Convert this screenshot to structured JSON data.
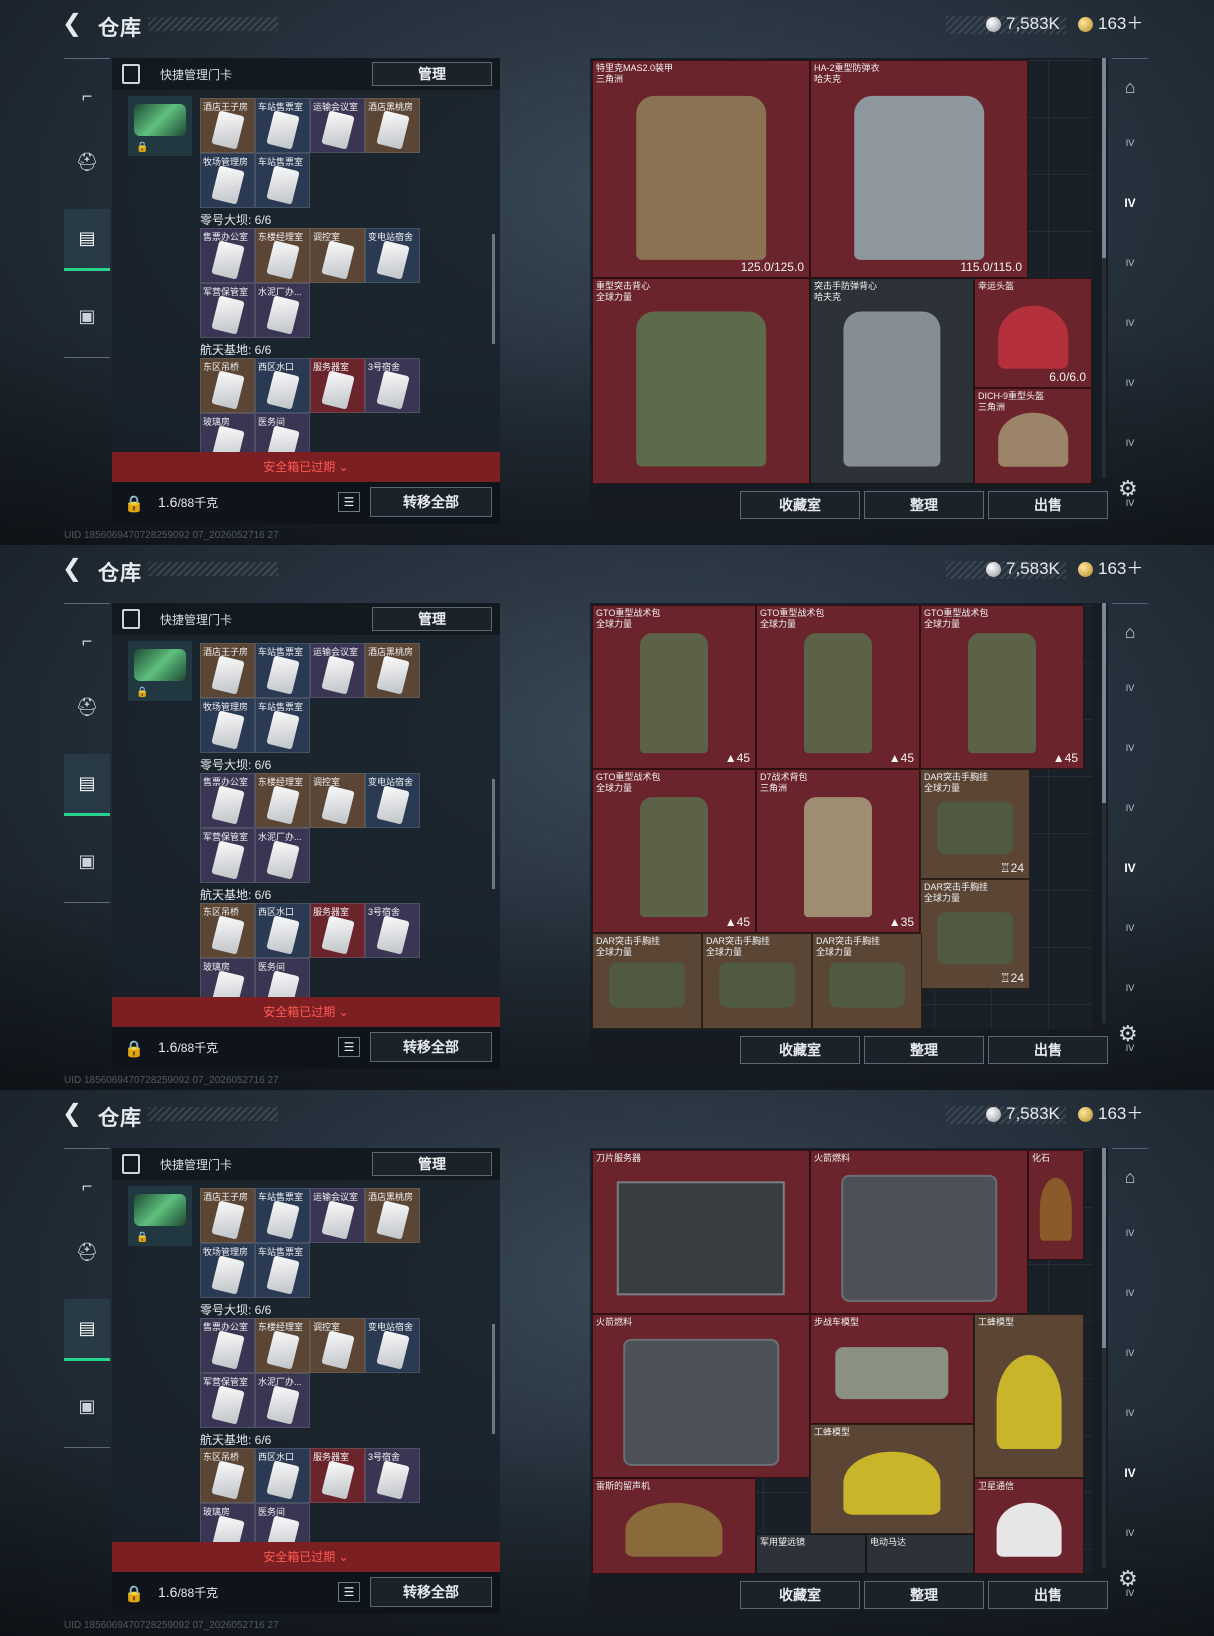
{
  "header": {
    "back": "❮",
    "title": "仓库",
    "currency1": "7,583K",
    "currency2": "163＋"
  },
  "card_panel": {
    "title": "快捷管理门卡",
    "manage": "管理",
    "groups": [
      {
        "label": "零号大坝: 6/6"
      },
      {
        "label": "航天基地: 6/6"
      }
    ],
    "cards": [
      "酒店王子房",
      "车站售票室",
      "运输会议室",
      "酒店黑桃房",
      "牧场管理房",
      "车站售票室",
      "售票办公室",
      "东楼经理室",
      "调控室",
      "变电站宿舍",
      "军营保管室",
      "水泥厂办...",
      "东区吊桥",
      "西区水口",
      "服务器室",
      "3号宿舍",
      "玻璃房",
      "医务间"
    ],
    "expired": "安全箱已过期 ⌄",
    "weight": "1.6",
    "weight_unit": "/88千克",
    "list_icon": "☰",
    "transfer": "转移全部"
  },
  "screens": [
    {
      "items": [
        {
          "name": "特里克MAS2.0装甲",
          "origin": "三角洲",
          "stat": "125.0/125.0"
        },
        {
          "name": "HA-2重型防弹衣",
          "origin": "哈夫克",
          "stat": "115.0/115.0"
        },
        {
          "name": "重型突击背心",
          "origin": "全球力量",
          "stat": ""
        },
        {
          "name": "突击手防弹背心",
          "origin": "哈夫克",
          "stat": ""
        },
        {
          "name": "幸运头盔",
          "origin": "",
          "stat": "6.0/6.0"
        },
        {
          "name": "DICH-9重型头盔",
          "origin": "三角洲",
          "stat": ""
        }
      ]
    },
    {
      "items": [
        {
          "name": "GTO重型战术包",
          "origin": "全球力量",
          "stat": "▲45"
        },
        {
          "name": "GTO重型战术包",
          "origin": "全球力量",
          "stat": "▲45"
        },
        {
          "name": "GTO重型战术包",
          "origin": "全球力量",
          "stat": "▲45"
        },
        {
          "name": "GTO重型战术包",
          "origin": "全球力量",
          "stat": "▲45"
        },
        {
          "name": "D7战术背包",
          "origin": "三角洲",
          "stat": "▲35"
        },
        {
          "name": "DAR突击手胸挂",
          "origin": "全球力量",
          "stat": "♖24"
        },
        {
          "name": "DAR突击手胸挂",
          "origin": "全球力量",
          "stat": "♖24"
        },
        {
          "name": "DAR突击手胸挂",
          "origin": "全球力量",
          "stat": ""
        },
        {
          "name": "DAR突击手胸挂",
          "origin": "全球力量",
          "stat": ""
        },
        {
          "name": "DAR突击手胸挂",
          "origin": "全球力量",
          "stat": ""
        }
      ]
    },
    {
      "items": [
        {
          "name": "刀片服务器",
          "origin": "",
          "stat": ""
        },
        {
          "name": "火箭燃料",
          "origin": "",
          "stat": ""
        },
        {
          "name": "化石",
          "origin": "",
          "stat": ""
        },
        {
          "name": "火箭燃料",
          "origin": "",
          "stat": ""
        },
        {
          "name": "步战车模型",
          "origin": "",
          "stat": ""
        },
        {
          "name": "工蜂模型",
          "origin": "",
          "stat": ""
        },
        {
          "name": "工蜂模型",
          "origin": "",
          "stat": ""
        },
        {
          "name": "雷斯的留声机",
          "origin": "",
          "stat": ""
        },
        {
          "name": "卫星通信",
          "origin": "",
          "stat": ""
        },
        {
          "name": "军用望远镜",
          "origin": "",
          "stat": ""
        },
        {
          "name": "电动马达",
          "origin": "",
          "stat": ""
        }
      ]
    }
  ],
  "storage_buttons": {
    "collection": "收藏室",
    "organize": "整理",
    "sell": "出售"
  },
  "right_tab_label": "IV",
  "watermark": "UID 1856069470728259092 07_2026052716 27",
  "colors": {
    "accent": "#27d48e",
    "item_red": "#6b242c",
    "item_brown": "#5b4534",
    "expired": "#7c1f22"
  },
  "icons": [
    "back-icon",
    "gun-icon",
    "helmet-icon",
    "card-icon",
    "briefcase-icon",
    "gear-icon",
    "lock-icon",
    "list-icon"
  ]
}
